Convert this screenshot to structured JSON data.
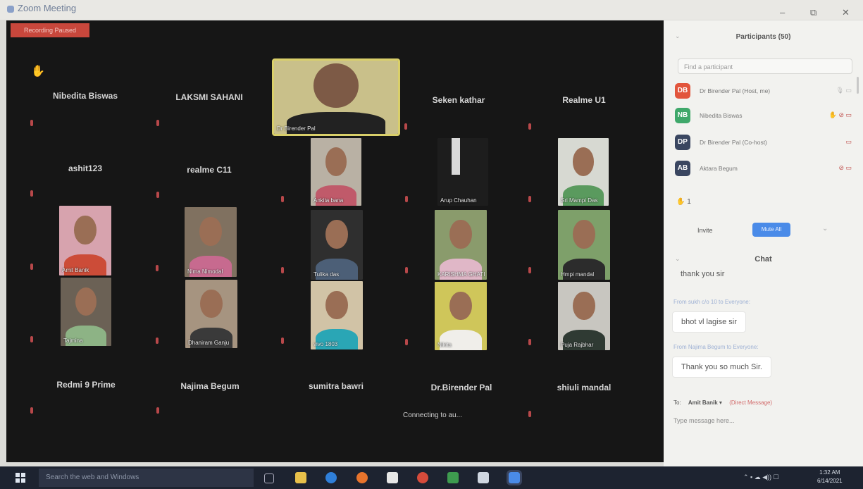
{
  "window": {
    "title": "Zoom Meeting",
    "minimize": "–",
    "maximize": "⧉",
    "close": "✕"
  },
  "meeting": {
    "recording_label": "Recording Paused",
    "connecting_status": "Connecting to au...",
    "name_tiles": {
      "nibedita": "Nibedita Biswas",
      "laksmi": "LAKSMI SAHANI",
      "seken": "Seken kathar",
      "realme_u1": "Realme U1",
      "ashit": "ashit123",
      "realme_c11": "realme C11",
      "redmi": "Redmi 9 Prime",
      "najima": "Najima Begum",
      "sumitra": "sumitra bawri",
      "birender2": "Dr.Birender Pal",
      "shiuli": "shiuli mandal"
    },
    "video_labels": {
      "speaker": "Dr Birender Pal",
      "ankita": "Ankita bana",
      "arup": "Arup Chauhan",
      "mampi": "Sri Mampi Das",
      "amit": "Amit Banik",
      "nima": "Nima Nimodal",
      "tulika": "Tulika das",
      "karishma": "KARISHMA GHATI",
      "hmpi": "Hmpi mandal",
      "tajmina": "Tajmina",
      "dhaniram": "Dhaniram Ganju",
      "vivo": "vivo 1803",
      "nikita": "Nikita",
      "puja": "Puja Rajbhar"
    }
  },
  "participants": {
    "title": "Participants (50)",
    "search_placeholder": "Find a participant",
    "list": [
      {
        "initials": "DB",
        "name": "Dr Birender Pal (Host, me)",
        "color": "#e2553c"
      },
      {
        "initials": "NB",
        "name": "Nibedita Biswas",
        "color": "#3fa86a"
      },
      {
        "initials": "DP",
        "name": "Dr Birender Pal (Co-host)",
        "color": "#3a4660"
      },
      {
        "initials": "AB",
        "name": "Aktara Begum",
        "color": "#3a4660"
      }
    ],
    "raised_hand_count": "1",
    "invite_label": "Invite",
    "mute_all_label": "Mute All"
  },
  "chat": {
    "title": "Chat",
    "messages": [
      {
        "from": "",
        "text": "thank you sir"
      },
      {
        "from": "From sukh c/o 10 to Everyone:",
        "text": "bhot vl lagise sir"
      },
      {
        "from": "From Najima Begum to Everyone:",
        "text": "Thank you so much Sir."
      }
    ],
    "to_label": "To:",
    "to_recipient": "Amit Banik",
    "direct_message": "(Direct Message)",
    "compose_placeholder": "Type message here..."
  },
  "taskbar": {
    "search_placeholder": "Search the web and Windows",
    "time": "1:32 AM",
    "date": "6/14/2021"
  },
  "colors": {
    "stage_bg": "#161616",
    "speaker_outline": "#d9cf6a",
    "accent": "#4a8be8",
    "recording": "#c8473c"
  }
}
